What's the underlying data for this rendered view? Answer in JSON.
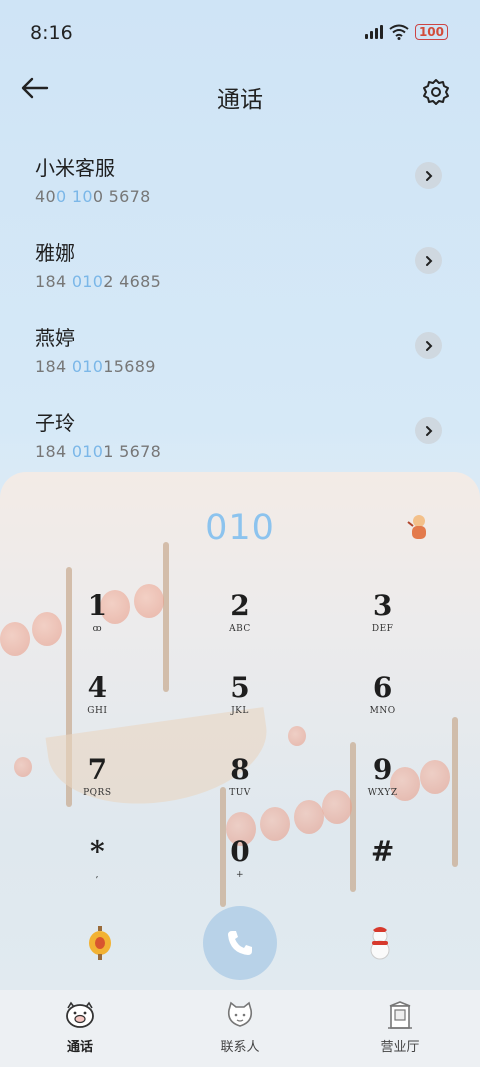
{
  "status_bar": {
    "time": "8:16",
    "battery": "100",
    "icons": [
      "signal-icon",
      "wifi-icon",
      "battery-icon"
    ]
  },
  "header": {
    "title": "通话",
    "back_icon": "back-arrow-icon",
    "settings_icon": "gear-icon"
  },
  "contacts": [
    {
      "name": "小米客服",
      "number_parts": [
        "40",
        "0",
        " ",
        "10",
        "0 5678"
      ]
    },
    {
      "name": "雅娜",
      "number_parts": [
        "184 ",
        "010",
        "2 4685"
      ]
    },
    {
      "name": "燕婷",
      "number_parts": [
        "184 ",
        "010",
        "15689"
      ]
    },
    {
      "name": "子玲",
      "number_parts": [
        "184 ",
        "010",
        "1 5678"
      ]
    }
  ],
  "dialer": {
    "input": "010",
    "keys": [
      {
        "digit": "1",
        "letters": "ꝏ"
      },
      {
        "digit": "2",
        "letters": "ABC"
      },
      {
        "digit": "3",
        "letters": "DEF"
      },
      {
        "digit": "4",
        "letters": "GHI"
      },
      {
        "digit": "5",
        "letters": "JKL"
      },
      {
        "digit": "6",
        "letters": "MNO"
      },
      {
        "digit": "7",
        "letters": "PQRS"
      },
      {
        "digit": "8",
        "letters": "TUV"
      },
      {
        "digit": "9",
        "letters": "WXYZ"
      },
      {
        "digit": "*",
        "letters": ","
      },
      {
        "digit": "0",
        "letters": "+"
      },
      {
        "digit": "#",
        "letters": ""
      }
    ]
  },
  "tabs": [
    {
      "label": "通话",
      "icon": "pig-phone-icon",
      "active": true
    },
    {
      "label": "联系人",
      "icon": "mascot-contacts-icon",
      "active": false
    },
    {
      "label": "营业厅",
      "icon": "shop-icon",
      "active": false
    }
  ],
  "colors": {
    "accent": "#8cc3ee",
    "highlight": "#7bb7e8",
    "call_button": "#b8d2e8"
  }
}
